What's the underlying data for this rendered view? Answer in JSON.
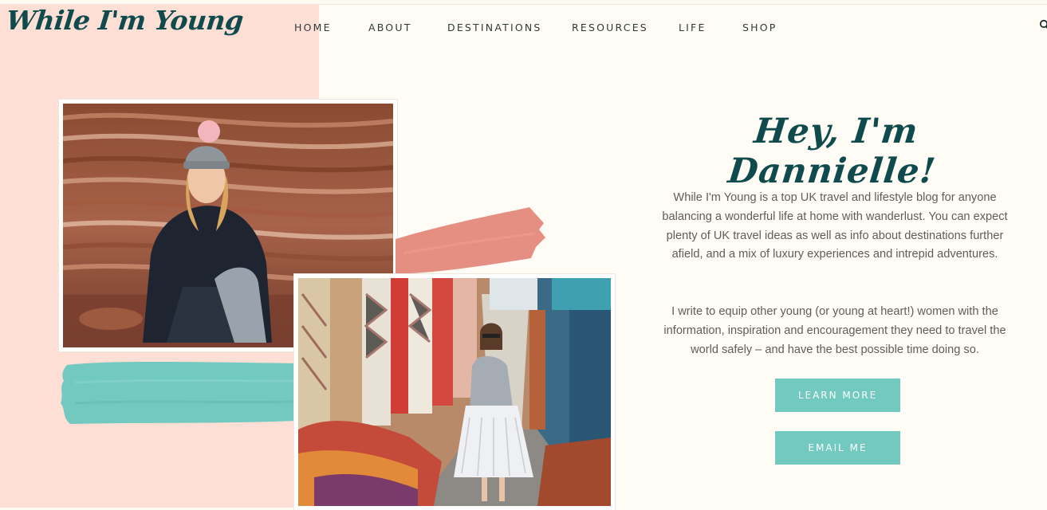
{
  "site": {
    "logo": "While I'm Young"
  },
  "nav": {
    "items": [
      "HOME",
      "ABOUT",
      "DESTINATIONS",
      "RESOURCES",
      "LIFE",
      "SHOP"
    ],
    "search_icon": "search-icon"
  },
  "hero": {
    "heading": "Hey, I'm Dannielle!",
    "paragraph_1": "While I'm Young is a top UK travel and lifestyle blog for anyone balancing a wonderful life at home with wanderlust. You can expect plenty of UK travel ideas as well as info about destinations further afield, and a mix of luxury experiences and intrepid adventures.",
    "paragraph_2": "I write to equip other young (or young at heart!) women with the information, inspiration and encouragement they need to travel the world safely – and have the best possible time doing so.",
    "buttons": {
      "learn_more": "LEARN MORE",
      "email_me": "EMAIL ME"
    }
  },
  "colors": {
    "brand_dark": "#0f4a4c",
    "accent_teal": "#72c9bf",
    "pink_panel": "#fddfd6",
    "salmon_brush": "#e58f82",
    "page_bg": "#fffcf5"
  }
}
